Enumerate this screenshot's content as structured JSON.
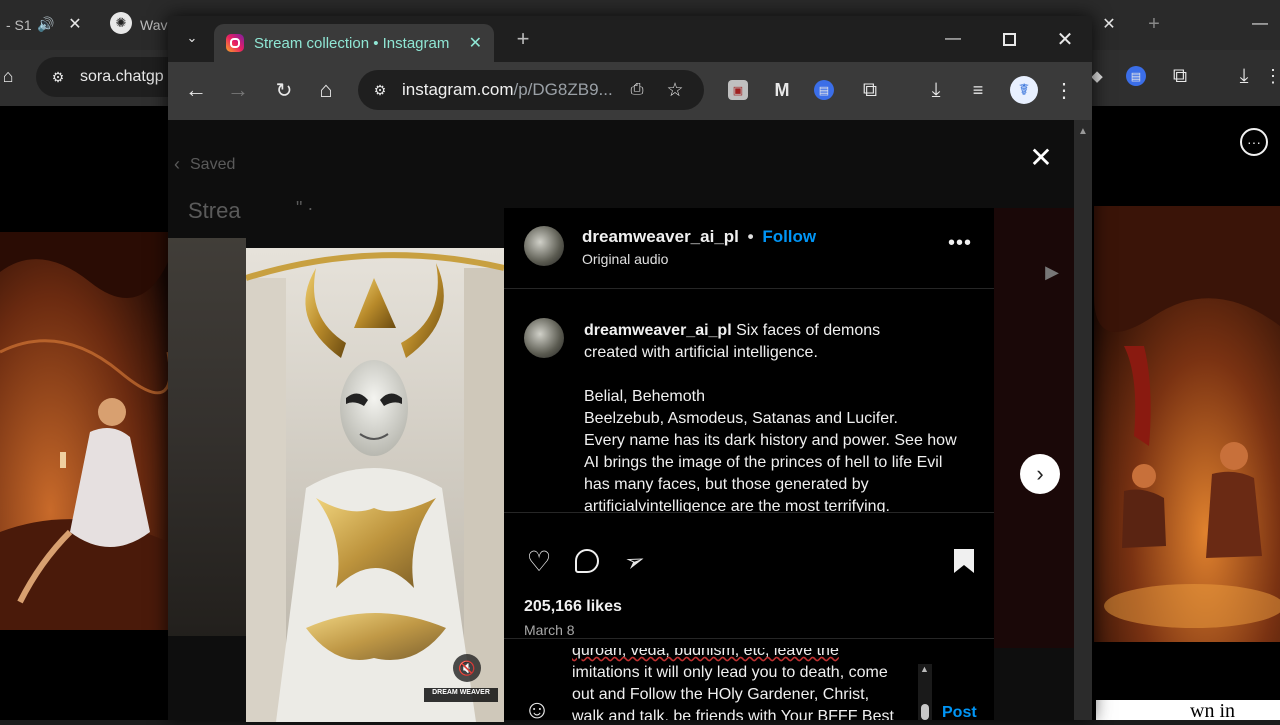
{
  "background_window": {
    "tab_fragment_1": "- S1",
    "tab_fragment_2": "Wav",
    "omnibox_url": "sora.chatgp"
  },
  "popup": {
    "tab_title": "Stream collection • Instagram",
    "url_host": "instagram.com",
    "url_path": "/p/DG8ZB9..."
  },
  "instagram": {
    "breadcrumb_label": "Saved",
    "collection_title_fragment": "Strea",
    "post": {
      "username": "dreamweaver_ai_pl",
      "follow_label": "Follow",
      "audio_label": "Original audio",
      "caption_username": "dreamweaver_ai_pl",
      "caption_line1": "Six faces of demons",
      "caption_line2": "created with artificial intelligence.",
      "caption_line3": "Belial, Behemoth",
      "caption_line4": "Beelzebub, Asmodeus, Satanas and Lucifer.",
      "caption_line5": "Every name has its dark history and power. See how",
      "caption_line6": "AI brings the image of the princes of hell to life Evil",
      "caption_line7": "has many faces, but those generated by",
      "caption_line8": "artificialvintelligence are the most terrifying.",
      "likes": "205,166 likes",
      "date": "March 8",
      "comment_line1": "quroan, veda, budhism, etc, leave the",
      "comment_line2": "imitations it will only lead you to death, come",
      "comment_line3": "out and Follow the HOly Gardener, Christ,",
      "comment_line4": "walk and talk, be friends with Your BFFF Best",
      "post_button": "Post",
      "watermark": "DREAM WEAVER"
    },
    "background_caption_fragment": "wn in"
  },
  "colors": {
    "instagram_blue": "#0095f6",
    "tab_text_teal": "#8fe6d4",
    "page_black": "#000000"
  }
}
